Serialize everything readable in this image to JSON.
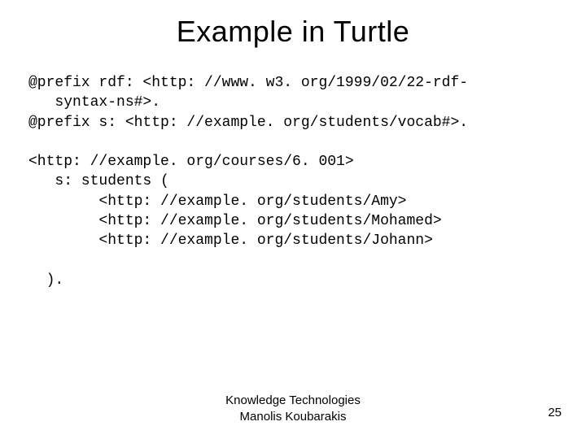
{
  "title": "Example in Turtle",
  "code": "@prefix rdf: <http: //www. w3. org/1999/02/22-rdf-\n   syntax-ns#>.\n@prefix s: <http: //example. org/students/vocab#>.\n\n<http: //example. org/courses/6. 001>\n   s: students (\n        <http: //example. org/students/Amy>\n        <http: //example. org/students/Mohamed>\n        <http: //example. org/students/Johann>\n\n  ).",
  "footer_line1": "Knowledge Technologies",
  "footer_line2": "Manolis Koubarakis",
  "page_number": "25"
}
